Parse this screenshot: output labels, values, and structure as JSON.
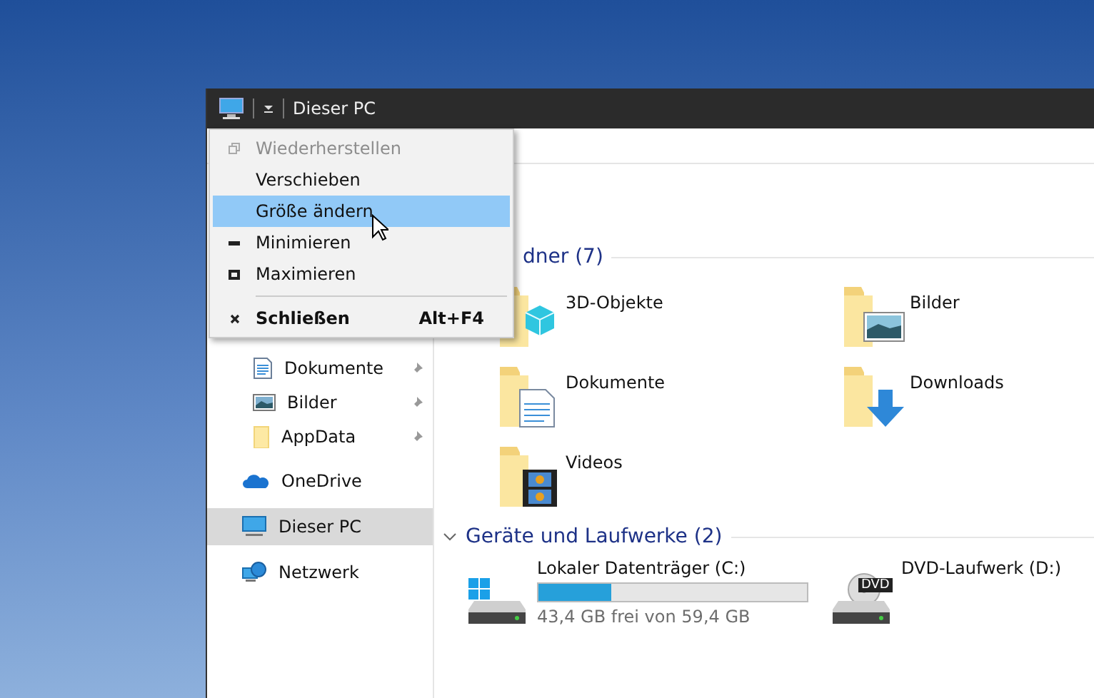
{
  "window": {
    "title": "Dieser PC"
  },
  "system_menu": [
    {
      "label": "Wiederherstellen",
      "kind": "restore",
      "disabled": true,
      "selected": false,
      "bold": false
    },
    {
      "label": "Verschieben",
      "kind": "none",
      "disabled": false,
      "selected": false,
      "bold": false
    },
    {
      "label": "Größe ändern",
      "kind": "none",
      "disabled": false,
      "selected": true,
      "bold": false
    },
    {
      "label": "Minimieren",
      "kind": "minimize",
      "disabled": false,
      "selected": false,
      "bold": false
    },
    {
      "label": "Maximieren",
      "kind": "maximize",
      "disabled": false,
      "selected": false,
      "bold": false
    },
    {
      "label": "Schließen",
      "kind": "close",
      "disabled": false,
      "selected": false,
      "bold": true,
      "shortcut": "Alt+F4"
    }
  ],
  "sidebar": {
    "items": [
      {
        "label": "Dokumente",
        "kind": "docs",
        "pinned": true,
        "selected": false
      },
      {
        "label": "Bilder",
        "kind": "pictures",
        "pinned": true,
        "selected": false
      },
      {
        "label": "AppData",
        "kind": "folder",
        "pinned": true,
        "selected": false
      },
      {
        "label": "OneDrive",
        "kind": "cloud",
        "pinned": false,
        "selected": false
      },
      {
        "label": "Dieser PC",
        "kind": "pc",
        "pinned": false,
        "selected": true
      },
      {
        "label": "Netzwerk",
        "kind": "network",
        "pinned": false,
        "selected": false
      }
    ]
  },
  "folders": {
    "header": "dner (7)",
    "items": [
      {
        "label": "3D-Objekte",
        "kind": "objects"
      },
      {
        "label": "Bilder",
        "kind": "pictures"
      },
      {
        "label": "Dokumente",
        "kind": "docs"
      },
      {
        "label": "Downloads",
        "kind": "downloads"
      },
      {
        "label": "Videos",
        "kind": "videos"
      }
    ]
  },
  "drives": {
    "header": "Geräte und Laufwerke (2)",
    "items": [
      {
        "label": "Lokaler Datenträger (C:)",
        "kind": "hdd",
        "level": 0.27,
        "info": "43,4 GB frei von 59,4 GB"
      },
      {
        "label": "DVD-Laufwerk (D:)",
        "kind": "dvd",
        "badge": "DVD"
      }
    ]
  }
}
